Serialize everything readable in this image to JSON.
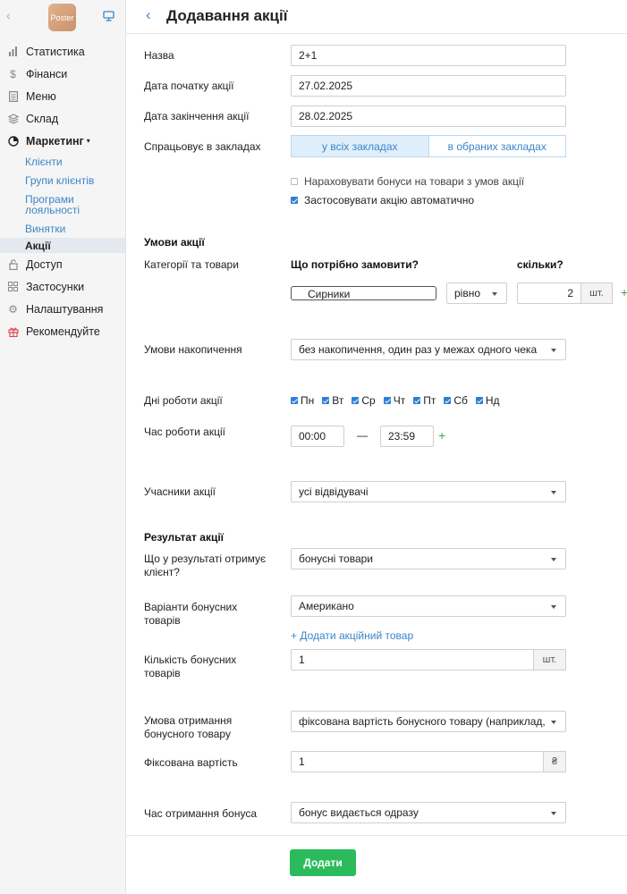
{
  "sidebar": {
    "logo_text": "Poster",
    "items": [
      {
        "label": "Статистика",
        "icon": "chart-icon"
      },
      {
        "label": "Фінанси",
        "icon": "dollar-icon"
      },
      {
        "label": "Меню",
        "icon": "document-icon"
      },
      {
        "label": "Склад",
        "icon": "layers-icon"
      },
      {
        "label": "Маркетинг",
        "icon": "pie-icon"
      },
      {
        "label": "Доступ",
        "icon": "lock-icon"
      },
      {
        "label": "Застосунки",
        "icon": "grid-icon"
      },
      {
        "label": "Налаштування",
        "icon": "gear-icon"
      },
      {
        "label": "Рекомендуйте",
        "icon": "gift-icon"
      }
    ],
    "marketing_caret": "▾",
    "sub": [
      "Клієнти",
      "Групи клієнтів",
      "Програми лояльності",
      "Винятки",
      "Акції"
    ]
  },
  "header": {
    "title": "Додавання акції"
  },
  "form": {
    "name_label": "Назва",
    "name_value": "2+1",
    "start_label": "Дата початку акції",
    "start_value": "27.02.2025",
    "end_label": "Дата закінчення акції",
    "end_value": "28.02.2025",
    "venues_label": "Спрацьовує в закладах",
    "venues_all": "у всіх закладах",
    "venues_selected": "в обраних закладах",
    "bonus_cb": "Нараховувати бонуси на товари з умов акції",
    "auto_cb": "Застосовувати акцію автоматично",
    "conditions_title": "Умови акції",
    "categories_label": "Категорії та товари",
    "what_order": "Що потрібно замовити?",
    "how_many": "скільки?",
    "product_value": "Сирники",
    "equal_value": "рівно",
    "qty_value": "2",
    "qty_unit": "шт.",
    "accum_label": "Умови накопичення",
    "accum_value": "без накопичення, один раз у межах одного чека",
    "days_label": "Дні роботи акції",
    "days": [
      "Пн",
      "Вт",
      "Ср",
      "Чт",
      "Пт",
      "Сб",
      "Нд"
    ],
    "time_label": "Час роботи акції",
    "time_from": "00:00",
    "time_dash": "—",
    "time_to": "23:59",
    "participants_label": "Учасники акції",
    "participants_value": "усі відвідувачі",
    "result_title": "Результат акції",
    "result_label": "Що у результаті отримує клієнт?",
    "result_value": "бонусні товари",
    "variants_label": "Варіанти бонусних товарів",
    "variants_value": "Американо",
    "add_product_link": "+ Додати акційний товар",
    "bonus_qty_label": "Кількість бонусних товарів",
    "bonus_qty_value": "1",
    "bonus_qty_unit": "шт.",
    "cond_label": "Умова отримання бонусного товару",
    "cond_value": "фіксована вартість бонусного товару (наприклад,",
    "fixed_label": "Фіксована вартість",
    "fixed_value": "1",
    "currency": "₴",
    "time_bonus_label": "Час отримання бонуса",
    "time_bonus_value": "бонус видається одразу"
  },
  "footer": {
    "add_label": "Додати"
  },
  "plus_symbol": "+"
}
